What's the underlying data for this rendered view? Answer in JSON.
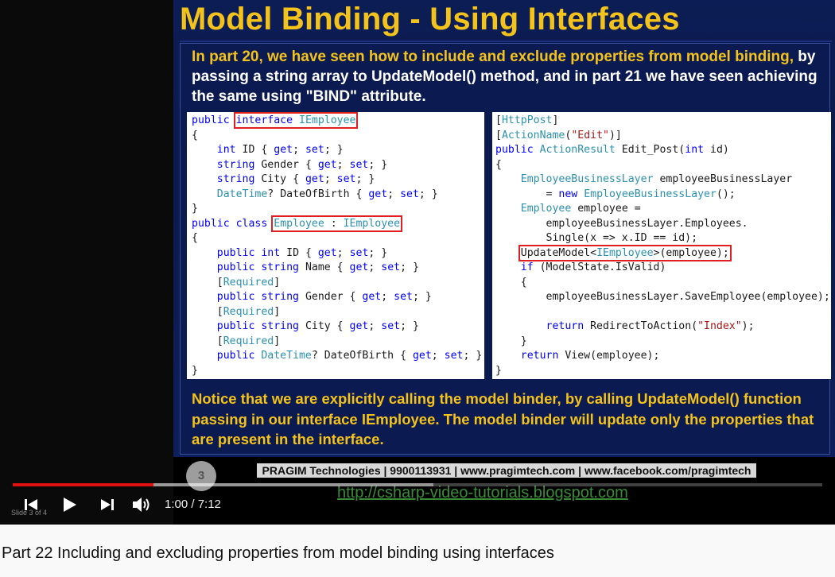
{
  "slide": {
    "title": "Model Binding - Using Interfaces",
    "intro_highlight": "In part 20, we have seen how to include and exclude properties from model binding,",
    "intro_rest": " by passing a string array to UpdateModel() method, and in part 21 we have seen achieving the same using \"BIND\" attribute.",
    "notice": "Notice that we are explicitly calling the model binder, by calling UpdateModel() function passing in our interface IEmployee. The model binder will update only the properties that are present in the interface.",
    "footer": "PRAGIM Technologies | 9900113931 | www.pragimtech.com | www.facebook.com/pragimtech",
    "blog_url": "http://csharp-video-tutorials.blogspot.com",
    "slide_number": "3",
    "slide_of": "Slide 3 of 4"
  },
  "code_left": {
    "public": "public",
    "interface_kw": "interface",
    "interface_name": "IEmployee",
    "class_kw": "class",
    "class_name": "Employee",
    "required": "Required",
    "datetime": "DateTime",
    "fields": {
      "id": "ID",
      "name": "Name",
      "gender": "Gender",
      "city": "City",
      "dob": "DateOfBirth"
    }
  },
  "code_right": {
    "httppost": "HttpPost",
    "action_name_attr": "ActionName",
    "action_name_value": "\"Edit\"",
    "action_result": "ActionResult",
    "method": "Edit_Post",
    "bl_type": "EmployeeBusinessLayer",
    "employee_type": "Employee",
    "update_model_call": "UpdateModel",
    "iemployee": "IEmployee",
    "index": "\"Index\""
  },
  "player": {
    "time": "1:00 / 7:12",
    "progress_played_pct": 17.4,
    "progress_buffered_pct": 52
  },
  "video_title": "Part 22 Including and excluding properties from model binding using interfaces",
  "colors": {
    "title_yellow": "#f3c21b",
    "slide_blue": "#0c1d55",
    "progress_red": "#e01010"
  }
}
